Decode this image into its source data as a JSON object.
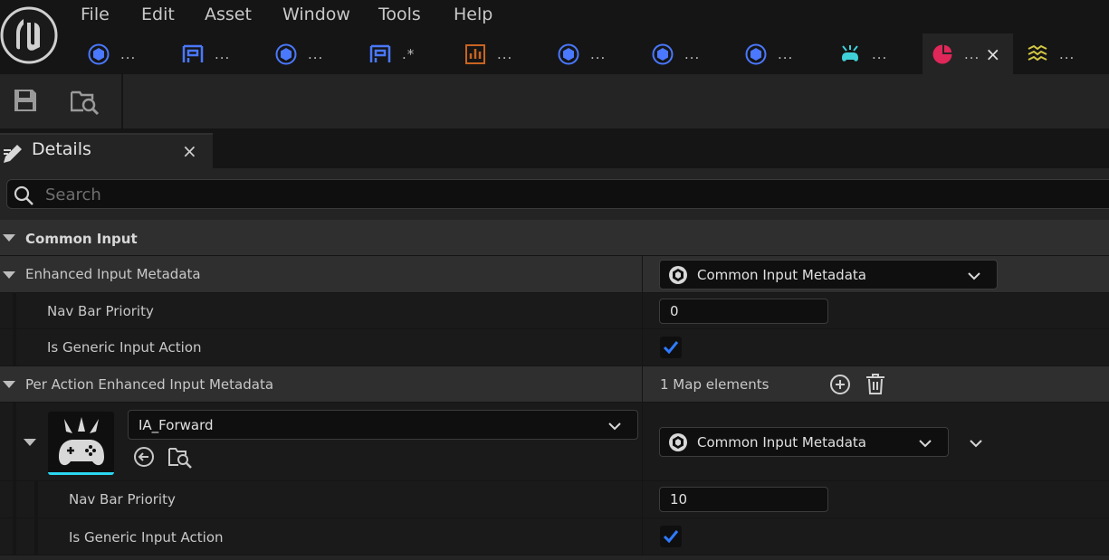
{
  "menu": {
    "file": "File",
    "edit": "Edit",
    "asset": "Asset",
    "window": "Window",
    "tools": "Tools",
    "help": "Help"
  },
  "tabs": [
    {
      "label": "...",
      "icon": "cube-icon"
    },
    {
      "label": "...",
      "icon": "blueprint-icon"
    },
    {
      "label": "...",
      "icon": "cube-icon"
    },
    {
      "label": ".*",
      "icon": "blueprint-icon"
    },
    {
      "label": "...",
      "icon": "data-table-icon"
    },
    {
      "label": "...",
      "icon": "cube-icon"
    },
    {
      "label": "...",
      "icon": "cube-icon"
    },
    {
      "label": "...",
      "icon": "cube-icon"
    },
    {
      "label": "...",
      "icon": "gamepad-icon"
    },
    {
      "label": "...",
      "icon": "input-action-icon",
      "active": true
    },
    {
      "label": "...",
      "icon": "mapping-context-icon"
    }
  ],
  "active_tab_close": "×",
  "panel": {
    "title": "Details",
    "close": "×"
  },
  "search": {
    "placeholder": "Search"
  },
  "details": {
    "category": "Common Input",
    "enhanced_label": "Enhanced Input Metadata",
    "enhanced_value": "Common Input Metadata",
    "nav_bar_priority_label": "Nav Bar Priority",
    "nav_bar_priority_value": "0",
    "is_generic_label": "Is Generic Input Action",
    "is_generic_checked": true,
    "per_action_label": "Per Action Enhanced Input Metadata",
    "map_elements": "1 Map elements",
    "entry_key": "IA_Forward",
    "entry_value": "Common Input Metadata",
    "entry_nav_bar_priority_label": "Nav Bar Priority",
    "entry_nav_bar_priority_value": "10",
    "entry_is_generic_label": "Is Generic Input Action",
    "entry_is_generic_checked": true
  },
  "colors": {
    "accent_blue": "#2f7bff",
    "checkbox_blue": "#2f7bff",
    "active_tab_icon": "#e0275a",
    "thumb_underline": "#2bd6f0"
  }
}
